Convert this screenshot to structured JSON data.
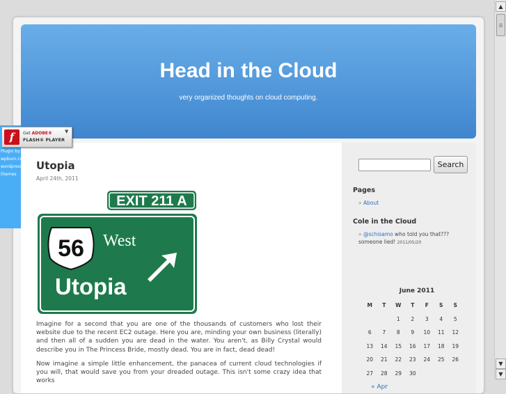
{
  "site": {
    "title": "Head in the Cloud",
    "tagline": "very organized thoughts on cloud computing."
  },
  "post": {
    "title": "Utopia",
    "date": "April 24th, 2011",
    "sign": {
      "exit_label": "EXIT 211 A",
      "route_number": "56",
      "direction": "West",
      "destination": "Utopia"
    },
    "paragraphs": [
      "Imagine for a second that you are one of the thousands of customers who lost their website due to the recent EC2 outage. Here you are, minding your own business (literally) and then all of a sudden you are dead in the water. You aren't, as Billy Crystal would describe you in The Princess Bride, mostly dead. You are in fact, dead dead!",
      "Now imagine a simple little enhancement, the panacea of current cloud technologies if you will, that would save you from your dreaded outage. This isn't some crazy idea that works"
    ]
  },
  "sidebar": {
    "search_button": "Search",
    "search_value": "",
    "pages_title": "Pages",
    "pages": [
      "About"
    ],
    "twitter_title": "Cole in the Cloud",
    "tweet": {
      "handle": "@schisamo",
      "text": " who told you that??? someone lied!",
      "date": "2011/05/20"
    },
    "calendar": {
      "caption": "June 2011",
      "days": [
        "M",
        "T",
        "W",
        "T",
        "F",
        "S",
        "S"
      ],
      "weeks": [
        [
          "",
          "",
          "1",
          "2",
          "3",
          "4",
          "5"
        ],
        [
          "6",
          "7",
          "8",
          "9",
          "10",
          "11",
          "12"
        ],
        [
          "13",
          "14",
          "15",
          "16",
          "17",
          "18",
          "19"
        ],
        [
          "20",
          "21",
          "22",
          "23",
          "24",
          "25",
          "26"
        ],
        [
          "27",
          "28",
          "29",
          "30",
          "",
          "",
          ""
        ]
      ],
      "prev": "« Apr"
    }
  },
  "flash": {
    "get": "Get",
    "adobe": "ADOBE®",
    "player": "FLASH® PLAYER",
    "plugin_note": "Plugin by wpburn.com wordpress themes"
  },
  "colors": {
    "header": "#4f96dc",
    "link": "#2a6fbf",
    "sign_green": "#1e7a4c",
    "flash_panel": "#4aaef7"
  }
}
